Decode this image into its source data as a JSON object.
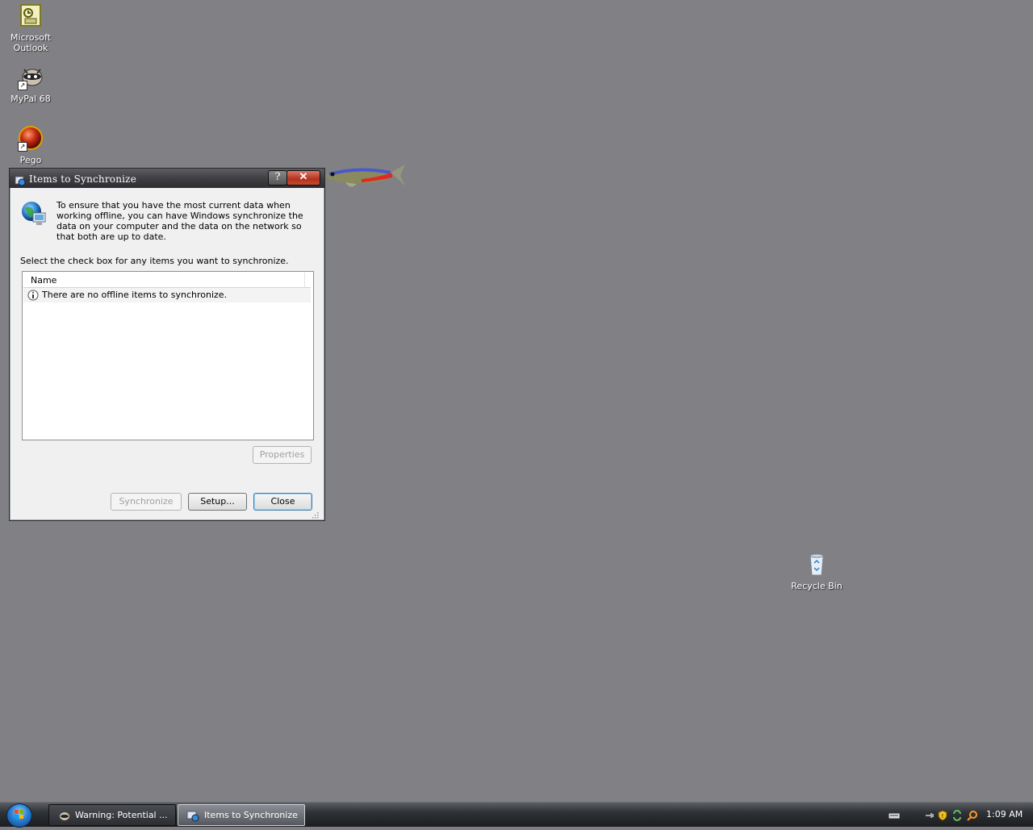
{
  "desktop": {
    "icons": [
      {
        "label_line1": "Microsoft",
        "label_line2": "Outlook"
      },
      {
        "label_line1": "MyPal 68"
      },
      {
        "label_line1": "Pego"
      },
      {
        "label_line1": "Recycle Bin"
      }
    ]
  },
  "dialog": {
    "title": "Items to Synchronize",
    "help_glyph": "?",
    "close_glyph": "✕",
    "intro": "To ensure that you have the most current data when working offline, you can have Windows synchronize the data on your computer and the data on the network so that both are up to date.",
    "instruction": "Select the check box for any items you want to synchronize.",
    "list": {
      "column_header": "Name",
      "rows": [
        {
          "text": "There are no offline items to synchronize."
        }
      ]
    },
    "buttons": {
      "properties": "Properties",
      "synchronize": "Synchronize",
      "setup": "Setup...",
      "close": "Close"
    }
  },
  "taskbar": {
    "items": [
      {
        "label": "Warning: Potential ...",
        "active": false
      },
      {
        "label": "Items to Synchronize",
        "active": true
      }
    ],
    "clock": "1:09 AM"
  },
  "colors": {
    "desktop": "#818185",
    "titlebar": "#3f3f44",
    "close_button": "#c84a33",
    "default_button_border": "#3c7fb1"
  }
}
